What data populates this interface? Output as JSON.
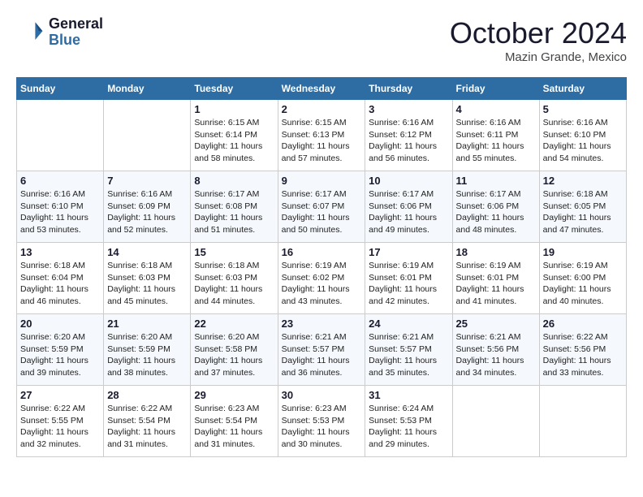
{
  "header": {
    "logo_general": "General",
    "logo_blue": "Blue",
    "month_title": "October 2024",
    "subtitle": "Mazin Grande, Mexico"
  },
  "days_of_week": [
    "Sunday",
    "Monday",
    "Tuesday",
    "Wednesday",
    "Thursday",
    "Friday",
    "Saturday"
  ],
  "weeks": [
    [
      {
        "day": "",
        "info": ""
      },
      {
        "day": "",
        "info": ""
      },
      {
        "day": "1",
        "sunrise": "6:15 AM",
        "sunset": "6:14 PM",
        "daylight": "11 hours and 58 minutes."
      },
      {
        "day": "2",
        "sunrise": "6:15 AM",
        "sunset": "6:13 PM",
        "daylight": "11 hours and 57 minutes."
      },
      {
        "day": "3",
        "sunrise": "6:16 AM",
        "sunset": "6:12 PM",
        "daylight": "11 hours and 56 minutes."
      },
      {
        "day": "4",
        "sunrise": "6:16 AM",
        "sunset": "6:11 PM",
        "daylight": "11 hours and 55 minutes."
      },
      {
        "day": "5",
        "sunrise": "6:16 AM",
        "sunset": "6:10 PM",
        "daylight": "11 hours and 54 minutes."
      }
    ],
    [
      {
        "day": "6",
        "sunrise": "6:16 AM",
        "sunset": "6:10 PM",
        "daylight": "11 hours and 53 minutes."
      },
      {
        "day": "7",
        "sunrise": "6:16 AM",
        "sunset": "6:09 PM",
        "daylight": "11 hours and 52 minutes."
      },
      {
        "day": "8",
        "sunrise": "6:17 AM",
        "sunset": "6:08 PM",
        "daylight": "11 hours and 51 minutes."
      },
      {
        "day": "9",
        "sunrise": "6:17 AM",
        "sunset": "6:07 PM",
        "daylight": "11 hours and 50 minutes."
      },
      {
        "day": "10",
        "sunrise": "6:17 AM",
        "sunset": "6:06 PM",
        "daylight": "11 hours and 49 minutes."
      },
      {
        "day": "11",
        "sunrise": "6:17 AM",
        "sunset": "6:06 PM",
        "daylight": "11 hours and 48 minutes."
      },
      {
        "day": "12",
        "sunrise": "6:18 AM",
        "sunset": "6:05 PM",
        "daylight": "11 hours and 47 minutes."
      }
    ],
    [
      {
        "day": "13",
        "sunrise": "6:18 AM",
        "sunset": "6:04 PM",
        "daylight": "11 hours and 46 minutes."
      },
      {
        "day": "14",
        "sunrise": "6:18 AM",
        "sunset": "6:03 PM",
        "daylight": "11 hours and 45 minutes."
      },
      {
        "day": "15",
        "sunrise": "6:18 AM",
        "sunset": "6:03 PM",
        "daylight": "11 hours and 44 minutes."
      },
      {
        "day": "16",
        "sunrise": "6:19 AM",
        "sunset": "6:02 PM",
        "daylight": "11 hours and 43 minutes."
      },
      {
        "day": "17",
        "sunrise": "6:19 AM",
        "sunset": "6:01 PM",
        "daylight": "11 hours and 42 minutes."
      },
      {
        "day": "18",
        "sunrise": "6:19 AM",
        "sunset": "6:01 PM",
        "daylight": "11 hours and 41 minutes."
      },
      {
        "day": "19",
        "sunrise": "6:19 AM",
        "sunset": "6:00 PM",
        "daylight": "11 hours and 40 minutes."
      }
    ],
    [
      {
        "day": "20",
        "sunrise": "6:20 AM",
        "sunset": "5:59 PM",
        "daylight": "11 hours and 39 minutes."
      },
      {
        "day": "21",
        "sunrise": "6:20 AM",
        "sunset": "5:59 PM",
        "daylight": "11 hours and 38 minutes."
      },
      {
        "day": "22",
        "sunrise": "6:20 AM",
        "sunset": "5:58 PM",
        "daylight": "11 hours and 37 minutes."
      },
      {
        "day": "23",
        "sunrise": "6:21 AM",
        "sunset": "5:57 PM",
        "daylight": "11 hours and 36 minutes."
      },
      {
        "day": "24",
        "sunrise": "6:21 AM",
        "sunset": "5:57 PM",
        "daylight": "11 hours and 35 minutes."
      },
      {
        "day": "25",
        "sunrise": "6:21 AM",
        "sunset": "5:56 PM",
        "daylight": "11 hours and 34 minutes."
      },
      {
        "day": "26",
        "sunrise": "6:22 AM",
        "sunset": "5:56 PM",
        "daylight": "11 hours and 33 minutes."
      }
    ],
    [
      {
        "day": "27",
        "sunrise": "6:22 AM",
        "sunset": "5:55 PM",
        "daylight": "11 hours and 32 minutes."
      },
      {
        "day": "28",
        "sunrise": "6:22 AM",
        "sunset": "5:54 PM",
        "daylight": "11 hours and 31 minutes."
      },
      {
        "day": "29",
        "sunrise": "6:23 AM",
        "sunset": "5:54 PM",
        "daylight": "11 hours and 31 minutes."
      },
      {
        "day": "30",
        "sunrise": "6:23 AM",
        "sunset": "5:53 PM",
        "daylight": "11 hours and 30 minutes."
      },
      {
        "day": "31",
        "sunrise": "6:24 AM",
        "sunset": "5:53 PM",
        "daylight": "11 hours and 29 minutes."
      },
      {
        "day": "",
        "info": ""
      },
      {
        "day": "",
        "info": ""
      }
    ]
  ]
}
